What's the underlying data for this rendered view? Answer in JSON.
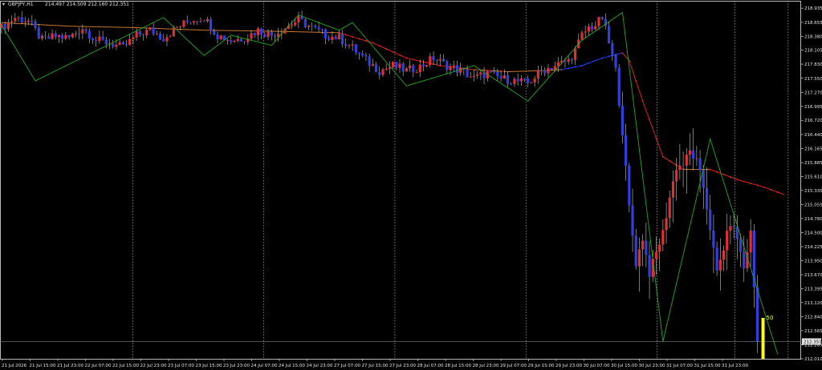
{
  "window": {
    "symbol": "GBPJPY,H1",
    "ohlc": "214.497 214.509 212.160 212.351"
  },
  "price_badge": "212.351",
  "bar_countdown": "50",
  "chart_data": {
    "type": "candlestick",
    "symbol": "GBPJPY",
    "timeframe": "H1",
    "ylim": [
      212.01,
      218.97
    ],
    "y_ticks": [
      "218.935",
      "218.655",
      "218.380",
      "218.105",
      "217.830",
      "217.550",
      "217.270",
      "216.995",
      "216.720",
      "216.440",
      "216.165",
      "215.885",
      "215.610",
      "215.335",
      "215.055",
      "214.780",
      "214.500",
      "214.225",
      "213.950",
      "213.670",
      "213.395",
      "213.120",
      "212.840",
      "212.565",
      "212.285",
      "212.010"
    ],
    "x_ticks": [
      "21 Jul 2026",
      "21 Jul 15:00",
      "21 Jul 23:00",
      "22 Jul 07:00",
      "22 Jul 15:00",
      "22 Jul 23:00",
      "23 Jul 07:00",
      "23 Jul 15:00",
      "23 Jul 23:00",
      "24 Jul 07:00",
      "24 Jul 15:00",
      "24 Jul 23:00",
      "27 Jul 07:00",
      "27 Jul 15:00",
      "27 Jul 23:00",
      "28 Jul 07:00",
      "28 Jul 15:00",
      "28 Jul 23:00",
      "29 Jul 07:00",
      "29 Jul 15:00",
      "29 Jul 23:00",
      "30 Jul 07:00",
      "30 Jul 15:00",
      "30 Jul 23:00",
      "31 Jul 07:00",
      "31 Jul 15:00",
      "31 Jul 23:00"
    ],
    "day_separators": [
      "22 Jul",
      "23 Jul",
      "24 Jul",
      "27 Jul",
      "28 Jul",
      "29 Jul",
      "30 Jul",
      "31 Jul"
    ],
    "current_price": 212.351,
    "close_path": [
      [
        0,
        218.55
      ],
      [
        4,
        218.75
      ],
      [
        8,
        218.68
      ],
      [
        12,
        218.3
      ],
      [
        16,
        218.38
      ],
      [
        20,
        218.35
      ],
      [
        24,
        218.55
      ],
      [
        28,
        218.3
      ],
      [
        32,
        218.25
      ],
      [
        36,
        218.15
      ],
      [
        40,
        218.4
      ],
      [
        44,
        218.5
      ],
      [
        48,
        218.35
      ],
      [
        52,
        218.55
      ],
      [
        56,
        218.7
      ],
      [
        60,
        218.75
      ],
      [
        64,
        218.4
      ],
      [
        68,
        218.3
      ],
      [
        72,
        218.35
      ],
      [
        76,
        218.5
      ],
      [
        80,
        218.4
      ],
      [
        84,
        218.55
      ],
      [
        88,
        218.7
      ],
      [
        92,
        218.55
      ],
      [
        96,
        218.4
      ],
      [
        100,
        218.35
      ],
      [
        104,
        218.15
      ],
      [
        108,
        217.9
      ],
      [
        112,
        217.7
      ],
      [
        116,
        217.8
      ],
      [
        120,
        217.7
      ],
      [
        124,
        217.78
      ],
      [
        128,
        217.95
      ],
      [
        132,
        217.8
      ],
      [
        136,
        217.7
      ],
      [
        140,
        217.55
      ],
      [
        144,
        217.65
      ],
      [
        148,
        217.55
      ],
      [
        152,
        217.5
      ],
      [
        156,
        217.45
      ],
      [
        160,
        217.7
      ],
      [
        164,
        217.8
      ],
      [
        168,
        217.9
      ],
      [
        170,
        218.1
      ],
      [
        172,
        218.4
      ],
      [
        174,
        218.55
      ],
      [
        176,
        218.6
      ],
      [
        178,
        218.75
      ],
      [
        180,
        218.25
      ],
      [
        182,
        217.7
      ],
      [
        184,
        216.5
      ],
      [
        186,
        215.0
      ],
      [
        188,
        213.9
      ],
      [
        190,
        214.4
      ],
      [
        192,
        213.7
      ],
      [
        194,
        214.1
      ],
      [
        196,
        214.5
      ],
      [
        198,
        215.2
      ],
      [
        200,
        215.8
      ],
      [
        202,
        215.85
      ],
      [
        204,
        216.1
      ],
      [
        206,
        215.9
      ],
      [
        208,
        215.4
      ],
      [
        210,
        214.6
      ],
      [
        212,
        213.7
      ],
      [
        214,
        214.2
      ],
      [
        216,
        214.7
      ],
      [
        218,
        214.4
      ],
      [
        220,
        213.8
      ],
      [
        222,
        214.5
      ],
      [
        224,
        212.35
      ]
    ],
    "zigzag": [
      [
        0,
        218.6
      ],
      [
        10,
        217.5
      ],
      [
        48,
        218.75
      ],
      [
        60,
        218.0
      ],
      [
        68,
        218.4
      ],
      [
        80,
        218.2
      ],
      [
        88,
        218.8
      ],
      [
        100,
        218.5
      ],
      [
        104,
        218.65
      ],
      [
        120,
        217.4
      ],
      [
        140,
        217.8
      ],
      [
        156,
        217.1
      ],
      [
        172,
        218.3
      ],
      [
        184,
        218.85
      ],
      [
        196,
        212.35
      ],
      [
        210,
        216.35
      ],
      [
        230,
        212.1
      ]
    ],
    "moving_average": [
      [
        0,
        218.65
      ],
      [
        20,
        218.58
      ],
      [
        40,
        218.55
      ],
      [
        60,
        218.5
      ],
      [
        80,
        218.48
      ],
      [
        100,
        218.45
      ],
      [
        110,
        218.25
      ],
      [
        120,
        217.95
      ],
      [
        130,
        217.8
      ],
      [
        140,
        217.72
      ],
      [
        150,
        217.68
      ],
      [
        160,
        217.7
      ],
      [
        166,
        217.72
      ],
      [
        172,
        217.8
      ],
      [
        178,
        217.95
      ],
      [
        184,
        218.05
      ],
      [
        186,
        217.9
      ],
      [
        190,
        217.1
      ],
      [
        196,
        216.0
      ],
      [
        202,
        215.75
      ],
      [
        210,
        215.75
      ],
      [
        218,
        215.55
      ],
      [
        226,
        215.4
      ],
      [
        232,
        215.25
      ]
    ]
  },
  "colors": {
    "background": "#000000",
    "foreground": "#e6e6e6",
    "bull_candle": "#e03030",
    "bear_candle": "#3040e0",
    "wick": "#c8c8c8",
    "ma_down": "#e02020",
    "ma_up": "#2040ff",
    "ma_flat": "#c87830",
    "zigzag": "#22aa22",
    "separator": "#c8c8c8",
    "volume_bar": "#ffff00",
    "bid_line": "#808080",
    "badge_bg": "#e6e6e6",
    "badge_fg": "#000000"
  },
  "icons": {
    "menu": "triangle-down-icon"
  }
}
